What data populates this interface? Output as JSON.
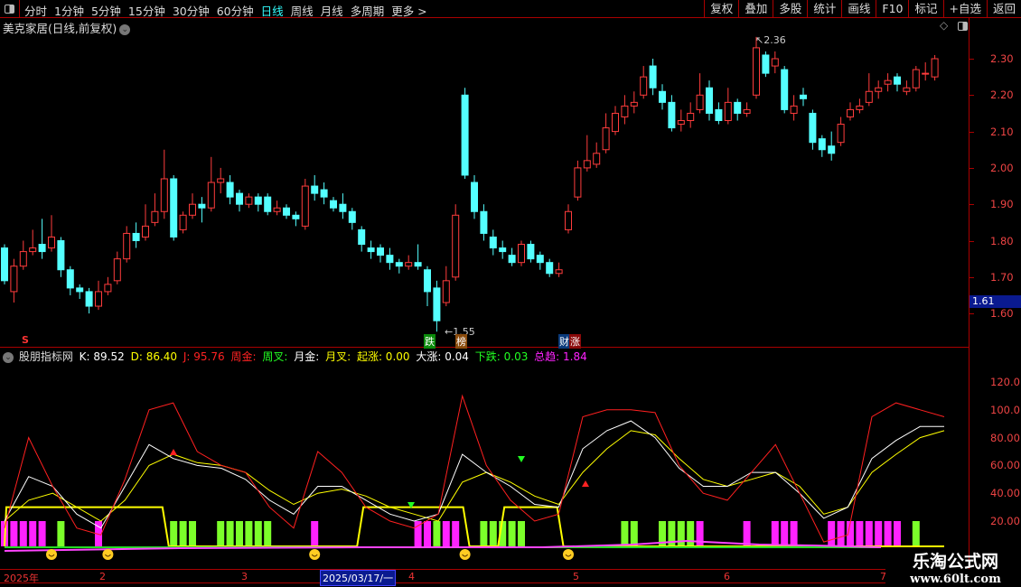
{
  "toolbar": {
    "periods": [
      "分时",
      "1分钟",
      "5分钟",
      "15分钟",
      "30分钟",
      "60分钟",
      "日线",
      "周线",
      "月线",
      "多周期",
      "更多 >"
    ],
    "active": 6,
    "buttons": [
      "复权",
      "叠加",
      "多股",
      "统计",
      "画线",
      "F10",
      "标记",
      "+自选",
      "返回"
    ]
  },
  "chart": {
    "title": "美克家居(日线,前复权)",
    "price_ticks": [
      "2.30",
      "2.20",
      "2.10",
      "2.00",
      "1.90",
      "1.80",
      "1.70",
      "1.60"
    ],
    "current_price": "1.61",
    "high_label": "2.36",
    "low_label": "1.55",
    "tags": [
      {
        "t": "跌",
        "bg": "#0a8a0a"
      },
      {
        "t": "榜",
        "bg": "#8a4a0a"
      },
      {
        "t": "财",
        "bg": "#0a3a7a"
      },
      {
        "t": "涨",
        "bg": "#8a0a0a"
      }
    ],
    "s_mark": "S",
    "colors": {
      "up": "#ff3c3c",
      "down": "#54ffff"
    },
    "candles": [
      [
        1.78,
        1.69,
        1.79,
        1.68
      ],
      [
        1.66,
        1.73,
        1.75,
        1.63
      ],
      [
        1.73,
        1.77,
        1.8,
        1.72
      ],
      [
        1.77,
        1.78,
        1.83,
        1.76
      ],
      [
        1.79,
        1.77,
        1.86,
        1.75
      ],
      [
        1.78,
        1.81,
        1.87,
        1.77
      ],
      [
        1.8,
        1.72,
        1.81,
        1.7
      ],
      [
        1.72,
        1.67,
        1.73,
        1.65
      ],
      [
        1.67,
        1.66,
        1.68,
        1.64
      ],
      [
        1.66,
        1.62,
        1.67,
        1.6
      ],
      [
        1.62,
        1.66,
        1.69,
        1.61
      ],
      [
        1.66,
        1.68,
        1.7,
        1.65
      ],
      [
        1.69,
        1.75,
        1.77,
        1.68
      ],
      [
        1.75,
        1.82,
        1.84,
        1.74
      ],
      [
        1.82,
        1.8,
        1.85,
        1.78
      ],
      [
        1.81,
        1.84,
        1.9,
        1.8
      ],
      [
        1.85,
        1.88,
        1.93,
        1.84
      ],
      [
        1.88,
        1.97,
        2.05,
        1.86
      ],
      [
        1.97,
        1.81,
        1.98,
        1.8
      ],
      [
        1.83,
        1.87,
        1.88,
        1.82
      ],
      [
        1.87,
        1.9,
        1.93,
        1.86
      ],
      [
        1.9,
        1.89,
        1.92,
        1.85
      ],
      [
        1.89,
        1.96,
        2.03,
        1.88
      ],
      [
        1.96,
        1.97,
        2.0,
        1.93
      ],
      [
        1.96,
        1.92,
        1.98,
        1.9
      ],
      [
        1.93,
        1.9,
        1.94,
        1.88
      ],
      [
        1.9,
        1.92,
        1.93,
        1.89
      ],
      [
        1.92,
        1.9,
        1.93,
        1.88
      ],
      [
        1.92,
        1.88,
        1.93,
        1.87
      ],
      [
        1.88,
        1.89,
        1.91,
        1.87
      ],
      [
        1.89,
        1.87,
        1.9,
        1.86
      ],
      [
        1.87,
        1.86,
        1.88,
        1.84
      ],
      [
        1.84,
        1.95,
        1.97,
        1.83
      ],
      [
        1.95,
        1.93,
        1.98,
        1.91
      ],
      [
        1.94,
        1.92,
        1.96,
        1.9
      ],
      [
        1.91,
        1.89,
        1.92,
        1.88
      ],
      [
        1.9,
        1.88,
        1.93,
        1.86
      ],
      [
        1.88,
        1.85,
        1.89,
        1.83
      ],
      [
        1.83,
        1.79,
        1.84,
        1.77
      ],
      [
        1.78,
        1.77,
        1.8,
        1.75
      ],
      [
        1.78,
        1.76,
        1.79,
        1.74
      ],
      [
        1.76,
        1.74,
        1.78,
        1.72
      ],
      [
        1.74,
        1.73,
        1.75,
        1.71
      ],
      [
        1.73,
        1.74,
        1.76,
        1.72
      ],
      [
        1.74,
        1.73,
        1.79,
        1.72
      ],
      [
        1.72,
        1.66,
        1.73,
        1.62
      ],
      [
        1.67,
        1.58,
        1.69,
        1.55
      ],
      [
        1.63,
        1.69,
        1.73,
        1.62
      ],
      [
        1.7,
        1.87,
        1.9,
        1.69
      ],
      [
        2.2,
        1.98,
        2.22,
        1.97
      ],
      [
        1.96,
        1.88,
        1.98,
        1.86
      ],
      [
        1.88,
        1.82,
        1.9,
        1.8
      ],
      [
        1.81,
        1.78,
        1.83,
        1.76
      ],
      [
        1.78,
        1.77,
        1.8,
        1.75
      ],
      [
        1.76,
        1.74,
        1.78,
        1.73
      ],
      [
        1.74,
        1.79,
        1.8,
        1.73
      ],
      [
        1.79,
        1.75,
        1.8,
        1.74
      ],
      [
        1.76,
        1.74,
        1.77,
        1.72
      ],
      [
        1.74,
        1.71,
        1.75,
        1.7
      ],
      [
        1.71,
        1.72,
        1.74,
        1.7
      ],
      [
        1.83,
        1.88,
        1.9,
        1.82
      ],
      [
        1.92,
        2.0,
        2.02,
        1.91
      ],
      [
        2.0,
        2.02,
        2.09,
        1.99
      ],
      [
        2.01,
        2.04,
        2.07,
        2.0
      ],
      [
        2.05,
        2.11,
        2.15,
        2.04
      ],
      [
        2.1,
        2.15,
        2.17,
        2.09
      ],
      [
        2.14,
        2.17,
        2.2,
        2.12
      ],
      [
        2.17,
        2.18,
        2.21,
        2.15
      ],
      [
        2.2,
        2.25,
        2.28,
        2.19
      ],
      [
        2.28,
        2.22,
        2.3,
        2.2
      ],
      [
        2.21,
        2.18,
        2.23,
        2.16
      ],
      [
        2.18,
        2.11,
        2.2,
        2.1
      ],
      [
        2.12,
        2.13,
        2.16,
        2.1
      ],
      [
        2.13,
        2.15,
        2.18,
        2.11
      ],
      [
        2.16,
        2.2,
        2.26,
        2.15
      ],
      [
        2.22,
        2.15,
        2.24,
        2.13
      ],
      [
        2.16,
        2.13,
        2.18,
        2.12
      ],
      [
        2.13,
        2.18,
        2.22,
        2.12
      ],
      [
        2.18,
        2.15,
        2.19,
        2.13
      ],
      [
        2.15,
        2.16,
        2.18,
        2.14
      ],
      [
        2.2,
        2.33,
        2.36,
        2.19
      ],
      [
        2.31,
        2.26,
        2.32,
        2.25
      ],
      [
        2.28,
        2.3,
        2.32,
        2.26
      ],
      [
        2.27,
        2.16,
        2.28,
        2.15
      ],
      [
        2.15,
        2.17,
        2.2,
        2.13
      ],
      [
        2.2,
        2.19,
        2.22,
        2.17
      ],
      [
        2.15,
        2.07,
        2.16,
        2.05
      ],
      [
        2.08,
        2.05,
        2.09,
        2.03
      ],
      [
        2.06,
        2.04,
        2.1,
        2.02
      ],
      [
        2.07,
        2.12,
        2.14,
        2.06
      ],
      [
        2.14,
        2.16,
        2.18,
        2.13
      ],
      [
        2.16,
        2.17,
        2.19,
        2.15
      ],
      [
        2.18,
        2.21,
        2.26,
        2.17
      ],
      [
        2.21,
        2.22,
        2.24,
        2.19
      ],
      [
        2.23,
        2.24,
        2.26,
        2.21
      ],
      [
        2.25,
        2.23,
        2.26,
        2.21
      ],
      [
        2.21,
        2.22,
        2.24,
        2.2
      ],
      [
        2.22,
        2.27,
        2.28,
        2.21
      ],
      [
        2.26,
        2.26,
        2.29,
        2.24
      ],
      [
        2.25,
        2.3,
        2.31,
        2.24
      ]
    ]
  },
  "indicator": {
    "name": "股朋指标网",
    "K": "K: 89.52",
    "D": "D: 86.40",
    "J": "J: 95.76",
    "zhoujin": "周金:",
    "zhoucha": "周叉:",
    "yuejin": "月金:",
    "yuecha": "月叉:",
    "qizhang": "起涨: 0.00",
    "dazhang": "大涨: 0.04",
    "xiadie": "下跌: 0.03",
    "zongqu": "总趋: 1.84",
    "ticks": [
      "120.0",
      "100.0",
      "80.00",
      "60.00",
      "40.00",
      "20.00"
    ],
    "J_series": [
      15,
      80,
      45,
      15,
      10,
      50,
      100,
      105,
      70,
      60,
      55,
      30,
      15,
      70,
      55,
      30,
      20,
      15,
      25,
      110,
      60,
      35,
      20,
      25,
      95,
      100,
      100,
      98,
      60,
      40,
      35,
      55,
      75,
      40,
      5,
      10,
      95,
      105,
      100,
      95
    ],
    "K_series": [
      20,
      52,
      45,
      25,
      15,
      45,
      75,
      65,
      60,
      58,
      50,
      35,
      25,
      45,
      45,
      35,
      25,
      20,
      25,
      68,
      55,
      45,
      32,
      30,
      72,
      85,
      92,
      80,
      58,
      45,
      45,
      55,
      55,
      40,
      22,
      30,
      65,
      78,
      88,
      88
    ],
    "D_series": [
      20,
      35,
      40,
      30,
      20,
      35,
      60,
      68,
      62,
      60,
      55,
      42,
      32,
      40,
      43,
      38,
      30,
      25,
      20,
      48,
      55,
      48,
      38,
      32,
      55,
      72,
      85,
      82,
      65,
      50,
      45,
      50,
      55,
      45,
      25,
      30,
      55,
      68,
      80,
      85
    ],
    "pink_bars": [
      0,
      1,
      2,
      3,
      4,
      10,
      33,
      44,
      45,
      47,
      48,
      74,
      79,
      82,
      83,
      84,
      88,
      89,
      90,
      91,
      92,
      93,
      94,
      95
    ],
    "green_bars": [
      6,
      18,
      19,
      20,
      23,
      24,
      25,
      26,
      27,
      28,
      46,
      51,
      52,
      53,
      54,
      55,
      66,
      67,
      70,
      71,
      72,
      73,
      97
    ],
    "yellow_steps": [
      [
        0,
        17
      ],
      [
        38,
        49
      ],
      [
        53,
        59
      ]
    ],
    "smileys": [
      5,
      11,
      33,
      49,
      60
    ]
  },
  "timeline": {
    "labels": [
      "2025年",
      "2",
      "3",
      "4",
      "5",
      "6",
      "7"
    ],
    "selected": "2025/03/17/一"
  },
  "watermark": {
    "title": "乐淘公式网",
    "url": "www.60lt.com"
  }
}
